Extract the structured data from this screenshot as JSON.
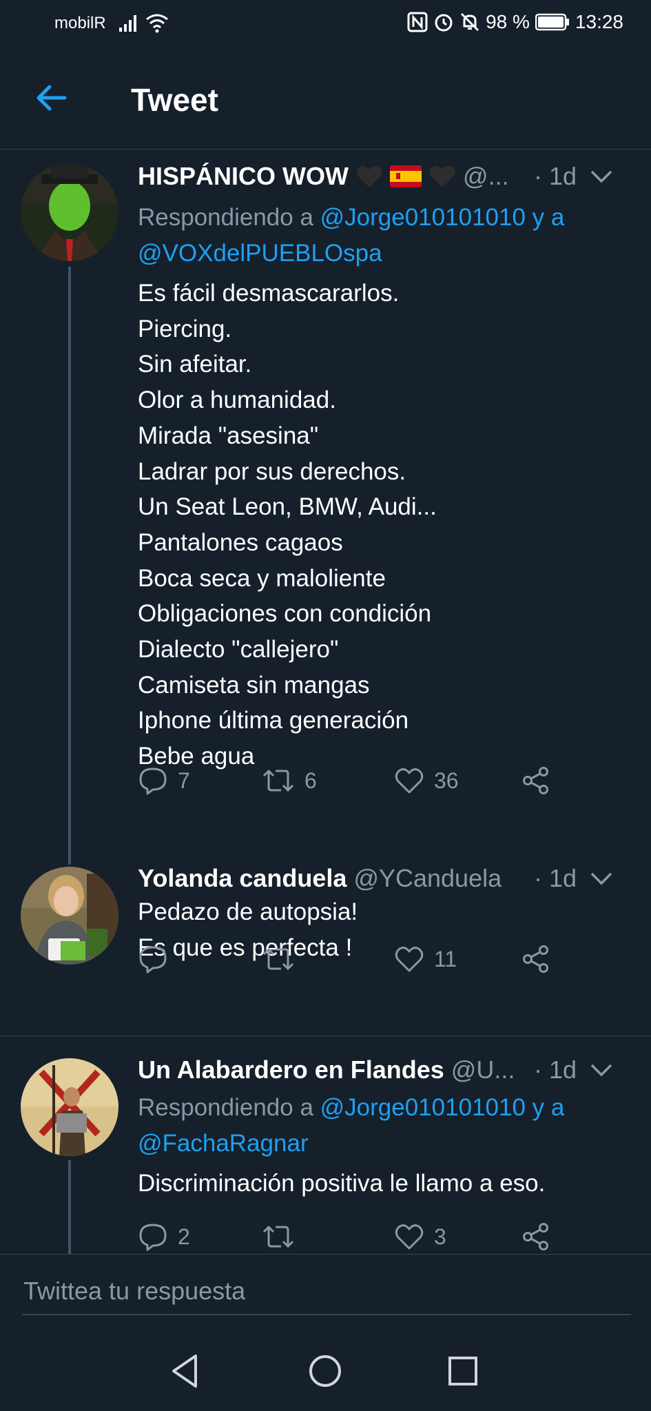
{
  "status_bar": {
    "carrier": "mobilR",
    "battery": "98 %",
    "time": "13:28",
    "icons": [
      "signal-icon",
      "wifi-icon",
      "nfc-icon",
      "alarm-icon",
      "mute-icon",
      "battery-icon"
    ]
  },
  "header": {
    "title": "Tweet",
    "back_icon": "arrow-left-icon"
  },
  "tweets": [
    {
      "name": "HISPÁNICO WOW",
      "handle": "@...",
      "time": "· 1d",
      "reply_prefix": "Respondiendo a ",
      "reply_mention_1": "@Jorge010101010",
      "reply_conj": " y a",
      "reply_mention_2": "@VOXdelPUEBLOspa",
      "text": "Es fácil desmascararlos.\nPiercing.\nSin afeitar.\nOlor a humanidad.\nMirada \"asesina\"\nLadrar por sus derechos.\nUn Seat Leon, BMW, Audi...\nPantalones cagaos\nBoca seca y maloliente\nObligaciones con condición\nDialecto \"callejero\"\nCamiseta sin mangas\nIphone última generación\nBebe agua",
      "replies": "7",
      "retweets": "6",
      "likes": "36"
    },
    {
      "name": "Yolanda canduela",
      "handle": "@YCanduela",
      "time": "· 1d",
      "text": "Pedazo de autopsia!\nEs que es perfecta !",
      "replies": "",
      "retweets": "",
      "likes": "11"
    },
    {
      "name": "Un Alabardero en Flandes",
      "handle": "@U...",
      "time": "· 1d",
      "reply_prefix": "Respondiendo a ",
      "reply_mention_1": "@Jorge010101010",
      "reply_conj": " y a",
      "reply_mention_2": "@FachaRagnar",
      "text": "Discriminación positiva le llamo a eso.",
      "replies": "2",
      "retweets": "",
      "likes": "3"
    }
  ],
  "composer": {
    "placeholder": "Twittea tu respuesta"
  },
  "colors": {
    "background": "#15202b",
    "accent": "#1da1f2",
    "secondary_text": "#8899a6",
    "divider": "#38444d"
  }
}
